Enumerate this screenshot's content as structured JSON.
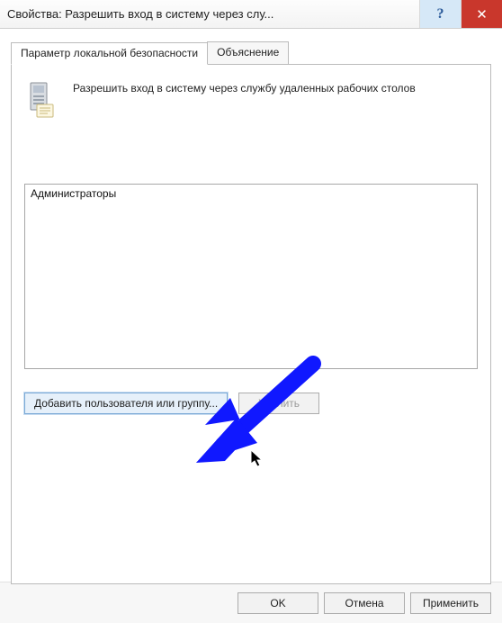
{
  "window": {
    "title": "Свойства: Разрешить вход в систему через слу..."
  },
  "tabs": {
    "local": "Параметр локальной безопасности",
    "explain": "Объяснение"
  },
  "policy": {
    "description": "Разрешить вход в систему через службу удаленных рабочих столов"
  },
  "list": {
    "items": [
      "Администраторы"
    ]
  },
  "buttons": {
    "add": "Добавить пользователя или группу...",
    "remove": "Удалить",
    "ok": "OK",
    "cancel": "Отмена",
    "apply": "Применить"
  }
}
